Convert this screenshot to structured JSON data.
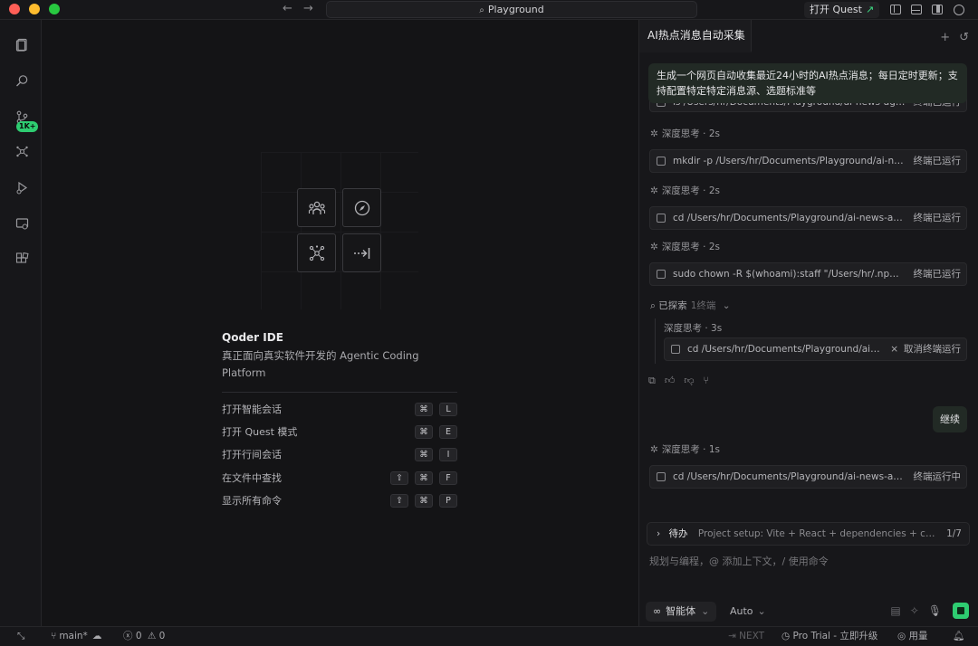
{
  "titlebar": {
    "back_icon": "←",
    "forward_icon": "→",
    "search_text": "Playground",
    "quest_label": "打开 Quest"
  },
  "activity": {
    "badge": "1K+"
  },
  "welcome": {
    "title": "Qoder IDE",
    "subtitle": "真正面向真实软件开发的 Agentic Coding Platform",
    "commands": [
      {
        "label": "打开智能会话",
        "keys": [
          "⌘",
          "L"
        ]
      },
      {
        "label": "打开 Quest 模式",
        "keys": [
          "⌘",
          "E"
        ]
      },
      {
        "label": "打开行间会话",
        "keys": [
          "⌘",
          "I"
        ]
      },
      {
        "label": "在文件中查找",
        "keys": [
          "⇧",
          "⌘",
          "F"
        ]
      },
      {
        "label": "显示所有命令",
        "keys": [
          "⇧",
          "⌘",
          "P"
        ]
      }
    ]
  },
  "panel": {
    "tab_title": "AI热点消息自动采集",
    "user_message": "生成一个网页自动收集最近24小时的AI热点消息；每日定时更新；支持配置特定特定消息源、选题标准等",
    "partial_card": {
      "cmd": "ls /Users/hr/Documents/Playground/ai-news-aggr...",
      "status": "终端已运行"
    },
    "think_label_1": "深度思考 · 2s",
    "card_1": {
      "cmd": "mkdir -p /Users/hr/Documents/Playground/ai-new...",
      "status": "终端已运行"
    },
    "think_label_2": "深度思考 · 2s",
    "card_2": {
      "cmd": "cd /Users/hr/Documents/Playground/ai-news-aggr...",
      "status": "终端已运行"
    },
    "think_label_3": "深度思考 · 2s",
    "card_3": {
      "cmd": "sudo chown -R $(whoami):staff \"/Users/hr/.npm\" ...",
      "status": "终端已运行"
    },
    "explore_label": "已探索",
    "explore_count": "1终端",
    "nested_think": "深度思考 · 3s",
    "nested_card": {
      "cmd": "cd /Users/hr/Documents/Playground/ai-n...",
      "status": "取消终端运行"
    },
    "continue_message": "继续",
    "think_label_4": "深度思考 · 1s",
    "card_4": {
      "cmd": "cd /Users/hr/Documents/Playground/ai-news-aggr...",
      "status": "终端运行中"
    },
    "todo_label": "待办",
    "todo_text": "Project setup: Vite + React + dependencies + conf...",
    "todo_count": "1/7",
    "input_placeholder": "规划与编程，@ 添加上下文，/ 使用命令",
    "agent_label": "智能体",
    "auto_label": "Auto"
  },
  "statusbar": {
    "branch": "main*",
    "errors": "0",
    "warnings": "0",
    "next_label": "NEXT",
    "pro_label": "Pro Trial - 立即升级",
    "usage_label": "用量"
  }
}
